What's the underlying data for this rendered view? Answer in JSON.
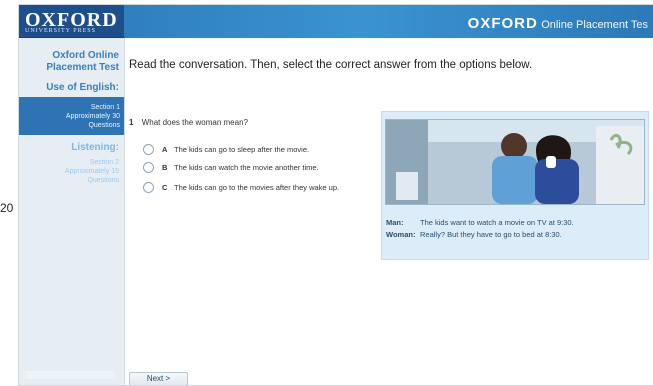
{
  "left_margin_number": "20",
  "brand": {
    "name": "OXFORD",
    "subtitle": "UNIVERSITY PRESS"
  },
  "header": {
    "brand": "OXFORD",
    "app_name": "Online Placement Tes"
  },
  "sidebar": {
    "title": "Oxford Online Placement Test",
    "section_use": "Use of English:",
    "active_item": {
      "line1": "Section 1",
      "line2": "Approximately 30",
      "line3": "Questions"
    },
    "section_listening": "Listening:",
    "listening_desc": {
      "line1": "Section 2",
      "line2": "Approximately 15",
      "line3": "Questions"
    }
  },
  "content": {
    "instruction": "Read the conversation. Then, select the correct answer from the options below.",
    "question": {
      "number": "1",
      "text": "What does the woman mean?"
    },
    "options": [
      {
        "letter": "A",
        "text": "The kids can go to sleep after the movie."
      },
      {
        "letter": "B",
        "text": "The kids can watch the movie another time."
      },
      {
        "letter": "C",
        "text": "The kids can go to the movies after they wake up."
      }
    ],
    "dialog": [
      {
        "speaker": "Man:",
        "line": "The kids want to watch a movie on TV at 9:30."
      },
      {
        "speaker": "Woman:",
        "line": "Really? But they have to go to bed at 8:30."
      }
    ]
  },
  "footer": {
    "next_label": "Next >"
  }
}
